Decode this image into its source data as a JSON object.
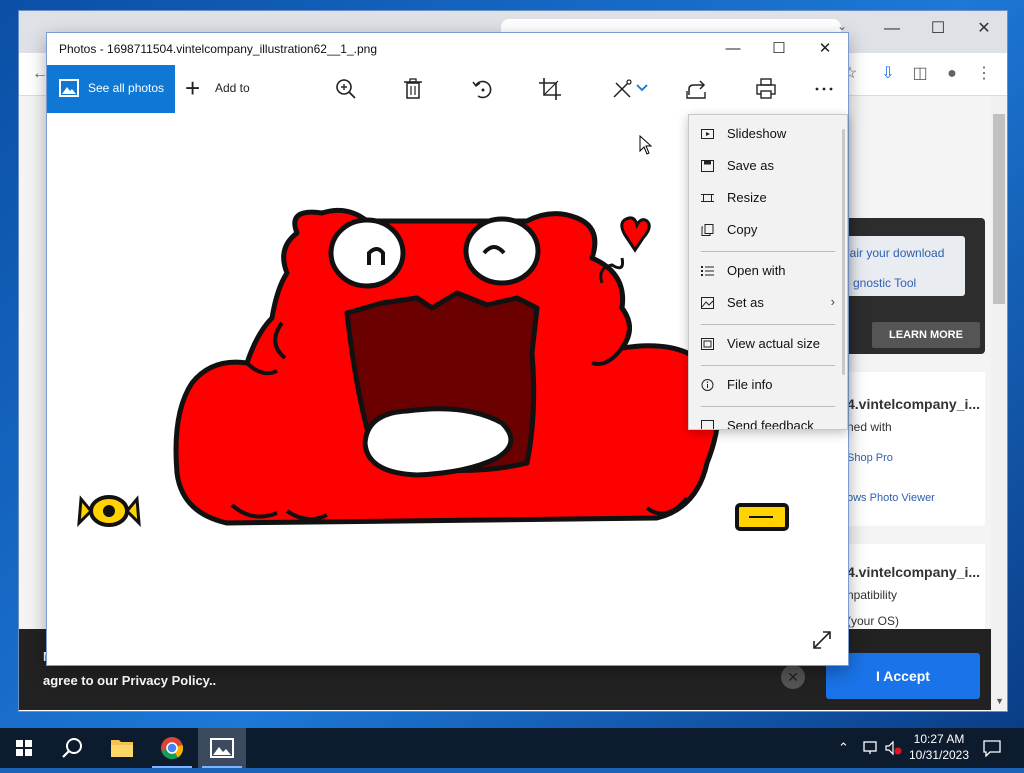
{
  "photos": {
    "title": "Photos - 1698711504.vintelcompany_illustration62__1_.png",
    "see_all_label": "See all photos",
    "add_to_label": "Add to"
  },
  "menu": {
    "items": [
      {
        "label": "Slideshow",
        "icon": "slideshow-icon"
      },
      {
        "label": "Save as",
        "icon": "save-icon"
      },
      {
        "label": "Resize",
        "icon": "resize-icon"
      },
      {
        "label": "Copy",
        "icon": "copy-icon"
      },
      {
        "label": "Open with",
        "icon": "open-with-icon"
      },
      {
        "label": "Set as",
        "icon": "set-as-icon"
      },
      {
        "label": "View actual size",
        "icon": "actual-size-icon"
      },
      {
        "label": "File info",
        "icon": "info-icon"
      },
      {
        "label": "Send feedback",
        "icon": "feedback-icon"
      }
    ]
  },
  "browser": {
    "ad_line1": "pair your download",
    "ad_line2": "gnostic Tool",
    "learn_more": "LEARN MORE",
    "card1": {
      "title": "4.vintelcompany_i...",
      "subtitle": "ned with",
      "link1": "Shop Pro",
      "link2": "ows Photo Viewer"
    },
    "card2": {
      "title": "4.vintelcompany_i...",
      "subtitle": "npatibility",
      "hint": "(your OS)"
    },
    "cookie_first": "M",
    "cookie_text": "agree to our Privacy Policy..",
    "cookie_gray": "",
    "accept_label": "I Accept"
  },
  "taskbar": {
    "time": "10:27 AM",
    "date": "10/31/2023"
  },
  "colors": {
    "accent": "#0f78d4",
    "accept_button": "#1a73e8",
    "crab_red": "#ff0000",
    "mouth_dark": "#6b0000"
  }
}
